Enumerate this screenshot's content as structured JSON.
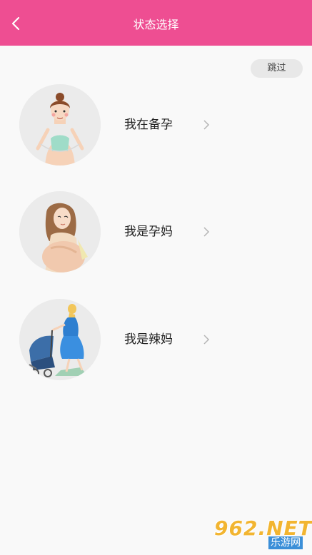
{
  "header": {
    "title": "状态选择",
    "back_icon": "back-arrow-icon",
    "color": "#ee4e92"
  },
  "skip_label": "跳过",
  "options": [
    {
      "label": "我在备孕"
    },
    {
      "label": "我是孕妈"
    },
    {
      "label": "我是辣妈"
    }
  ],
  "watermark": {
    "main": "962.NET",
    "sub": "乐游网"
  }
}
